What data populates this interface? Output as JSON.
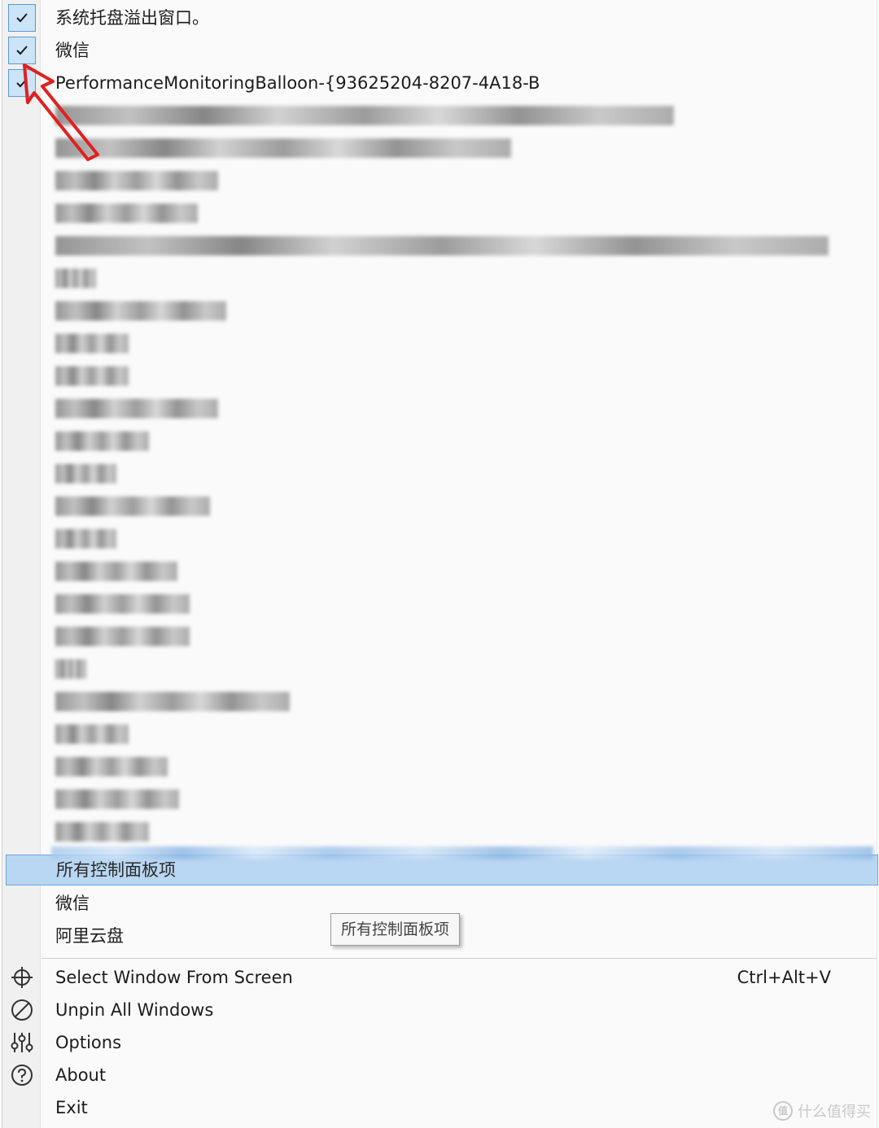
{
  "menu": {
    "checked_items": [
      {
        "label": "系统托盘溢出窗口。",
        "checked": true
      },
      {
        "label": "微信",
        "checked": true
      },
      {
        "label": "PerformanceMonitoringBalloon-{93625204-8207-4A18-B",
        "checked": true
      }
    ],
    "highlighted_item": {
      "label": "所有控制面板项"
    },
    "window_items_after": [
      "微信",
      "阿里云盘"
    ],
    "tooltip": "所有控制面板项",
    "commands": [
      {
        "label": "Select Window From Screen",
        "shortcut": "Ctrl+Alt+V",
        "icon": "crosshair-icon"
      },
      {
        "label": "Unpin All Windows",
        "shortcut": "",
        "icon": "prohibited-icon"
      },
      {
        "label": "Options",
        "shortcut": "",
        "icon": "sliders-icon"
      },
      {
        "label": "About",
        "shortcut": "",
        "icon": "question-circle-icon"
      },
      {
        "label": "Exit",
        "shortcut": "",
        "icon": ""
      }
    ]
  },
  "colors": {
    "check_background": "#cce4f7",
    "check_border": "#5a9bd5",
    "highlight": "#b9d6f2",
    "annotation_arrow": "#e02020"
  },
  "watermark": "什么值得买"
}
